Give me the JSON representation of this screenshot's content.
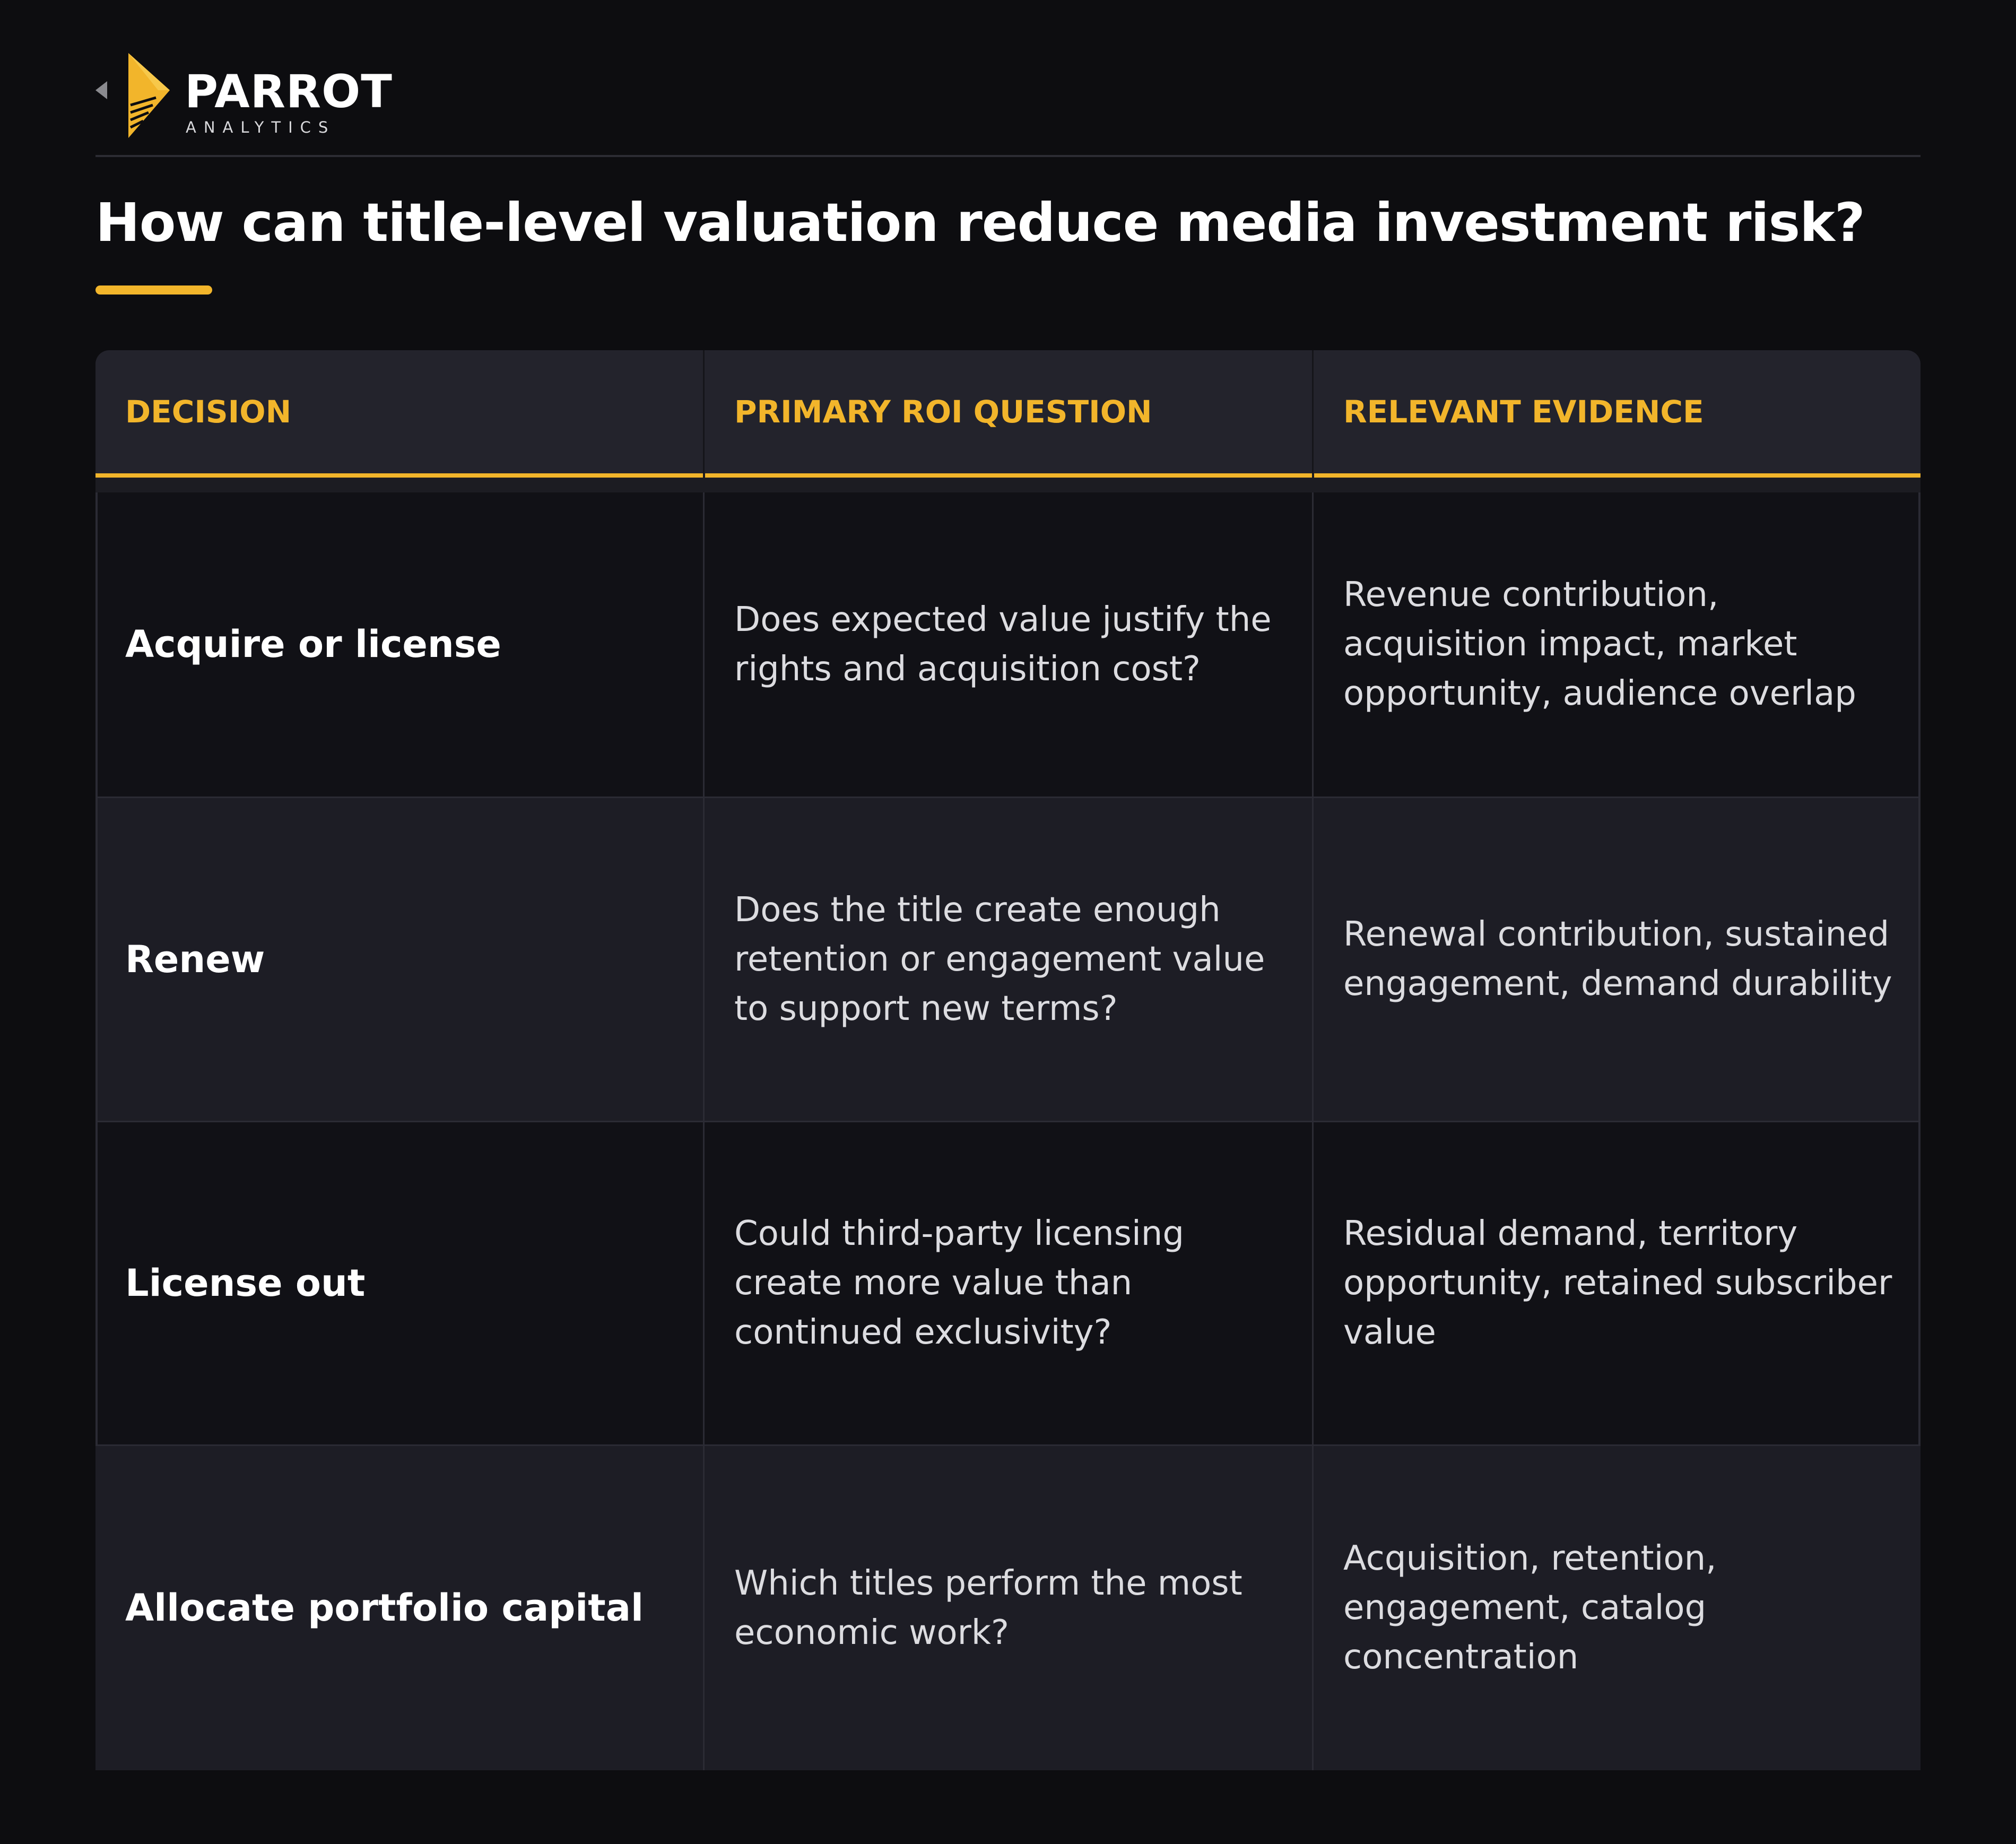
{
  "brand": {
    "name": "PARROT",
    "sub": "ANALYTICS",
    "accent": "#f2b52b",
    "icon": "parrot-logo-icon"
  },
  "title": "How can title-level valuation reduce media investment risk?",
  "colors": {
    "background": "#0d0d10",
    "header_bg": "#23232c",
    "row_dark": "#111116",
    "row_light": "#1d1d25",
    "accent": "#f2b52b",
    "text": "#ffffff",
    "muted_text": "#dcdce0"
  },
  "table": {
    "headers": [
      "DECISION",
      "PRIMARY ROI QUESTION",
      "RELEVANT EVIDENCE"
    ],
    "rows": [
      {
        "decision": "Acquire or license",
        "question": "Does expected value justify the rights and acquisition cost?",
        "evidence": "Revenue contribution, acquisition impact, market opportunity, audience overlap"
      },
      {
        "decision": "Renew",
        "question": "Does the title create enough retention or engagement value to support new terms?",
        "evidence": "Renewal contribution, sustained engagement, demand durability"
      },
      {
        "decision": "License out",
        "question": "Could third-party licensing create more value than continued exclusivity?",
        "evidence": "Residual demand, territory opportunity, retained subscriber value"
      },
      {
        "decision": "Allocate portfolio capital",
        "question": "Which titles perform the most economic work?",
        "evidence": "Acquisition, retention, engagement, catalog concentration"
      }
    ]
  }
}
